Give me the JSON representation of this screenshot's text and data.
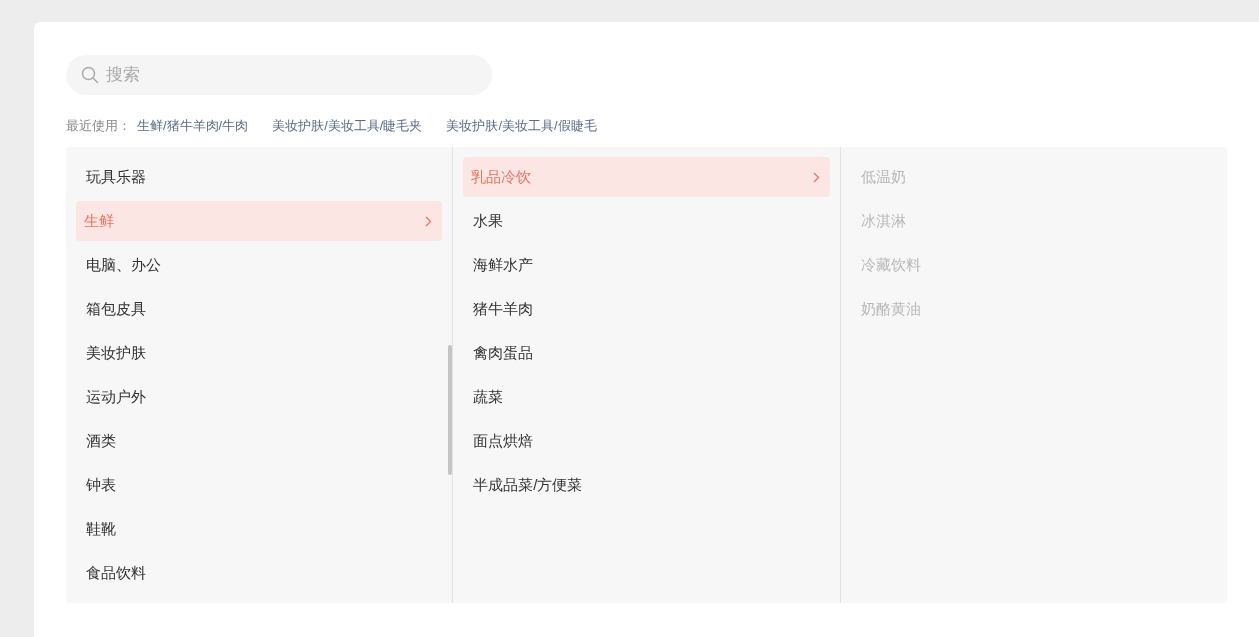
{
  "search": {
    "placeholder": "搜索"
  },
  "recent": {
    "label": "最近使用：",
    "items": [
      "生鲜/猪牛羊肉/牛肉",
      "美妆护肤/美妆工具/睫毛夹",
      "美妆护肤/美妆工具/假睫毛"
    ]
  },
  "columns": [
    {
      "items": [
        {
          "label": "玩具乐器",
          "selected": false
        },
        {
          "label": "生鲜",
          "selected": true
        },
        {
          "label": "电脑、办公",
          "selected": false
        },
        {
          "label": "箱包皮具",
          "selected": false
        },
        {
          "label": "美妆护肤",
          "selected": false
        },
        {
          "label": "运动户外",
          "selected": false
        },
        {
          "label": "酒类",
          "selected": false
        },
        {
          "label": "钟表",
          "selected": false
        },
        {
          "label": "鞋靴",
          "selected": false
        },
        {
          "label": "食品饮料",
          "selected": false
        }
      ]
    },
    {
      "items": [
        {
          "label": "乳品冷饮",
          "selected": true
        },
        {
          "label": "水果",
          "selected": false
        },
        {
          "label": "海鲜水产",
          "selected": false
        },
        {
          "label": "猪牛羊肉",
          "selected": false
        },
        {
          "label": "禽肉蛋品",
          "selected": false
        },
        {
          "label": "蔬菜",
          "selected": false
        },
        {
          "label": "面点烘焙",
          "selected": false
        },
        {
          "label": "半成品菜/方便菜",
          "selected": false
        }
      ]
    },
    {
      "items": [
        {
          "label": "低温奶",
          "selected": false
        },
        {
          "label": "冰淇淋",
          "selected": false
        },
        {
          "label": "冷藏饮料",
          "selected": false
        },
        {
          "label": "奶酪黄油",
          "selected": false
        }
      ]
    }
  ]
}
